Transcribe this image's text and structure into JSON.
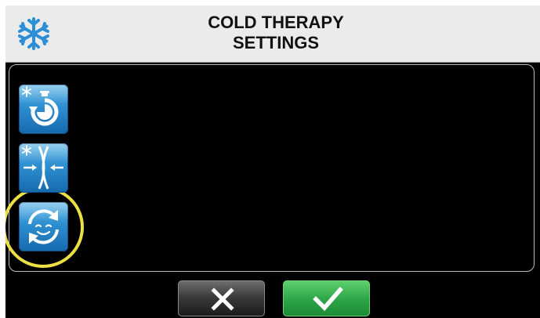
{
  "header": {
    "title_line1": "COLD THERAPY",
    "title_line2": "SETTINGS",
    "icon": "snowflake-icon"
  },
  "side_buttons": [
    {
      "icon": "cold-timer-icon"
    },
    {
      "icon": "cold-compression-icon"
    },
    {
      "icon": "cold-cycle-icon",
      "highlighted": true
    }
  ],
  "footer": {
    "cancel_icon": "x-icon",
    "confirm_icon": "checkmark-icon"
  },
  "colors": {
    "header_bg": "#ebebeb",
    "screen_bg": "#000000",
    "icon_blue": "#2e8fd0",
    "highlight": "#ece043",
    "confirm_green": "#2fa84a",
    "cancel_dark": "#3b3b3b"
  }
}
